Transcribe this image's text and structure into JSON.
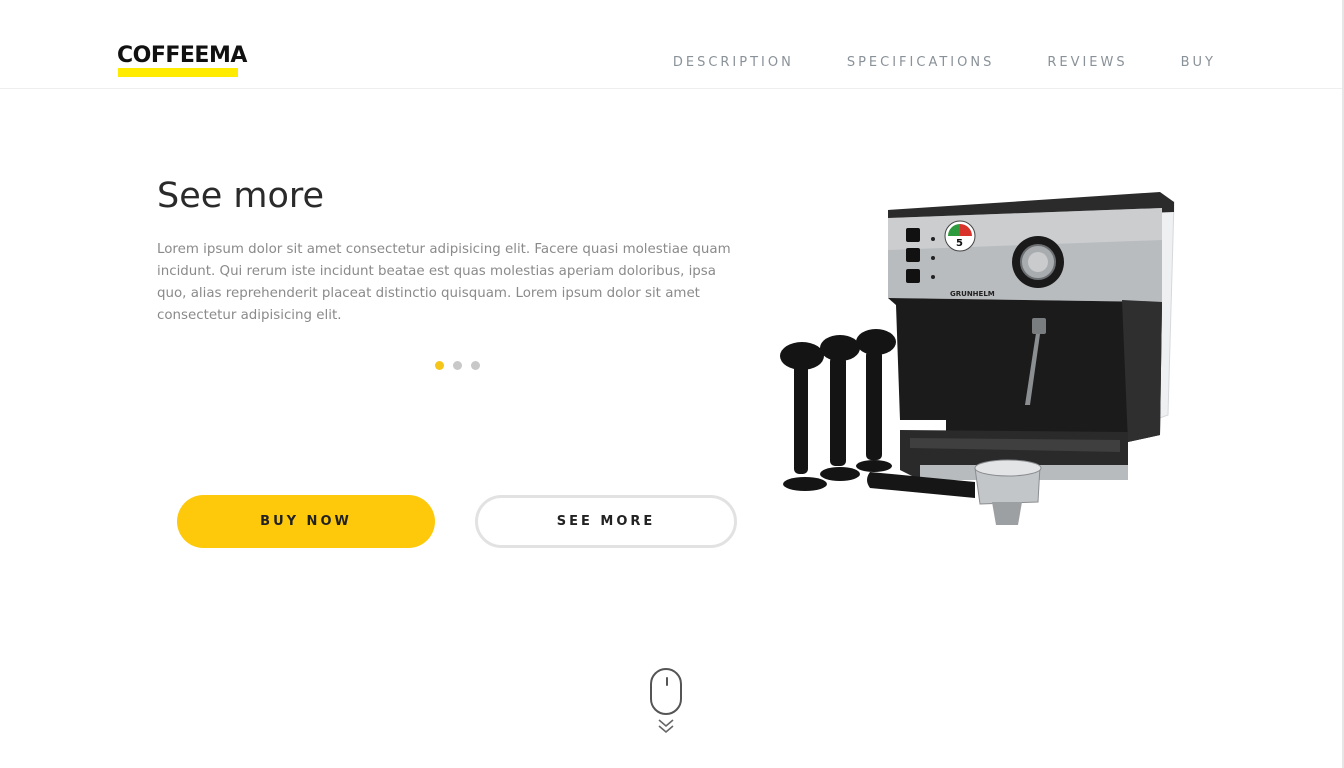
{
  "brand": {
    "logo_text": "COFFEEMA",
    "accent_color": "#fec90b"
  },
  "nav": {
    "items": [
      {
        "label": "DESCRIPTION"
      },
      {
        "label": "SPECIFICATIONS"
      },
      {
        "label": "REVIEWS"
      },
      {
        "label": "BUY"
      }
    ]
  },
  "hero": {
    "title": "See more",
    "description": "Lorem ipsum dolor sit amet consectetur adipisicing elit. Facere quasi molestiae quam incidunt. Qui rerum iste incidunt beatae est quas molestias aperiam doloribus, ipsa quo, alias reprehenderit placeat distinctio quisquam. Lorem ipsum dolor sit amet consectetur adipisicing elit.",
    "slider": {
      "count": 3,
      "active_index": 0
    },
    "buy_button_label": "BUY NOW",
    "see_more_button_label": "SEE MORE",
    "product_image": "espresso-machine-with-tampers",
    "machine_badge_text": "5",
    "machine_brand_text": "GRUNHELM"
  },
  "scroll_hint": {
    "icon": "mouse-scroll-icon"
  }
}
